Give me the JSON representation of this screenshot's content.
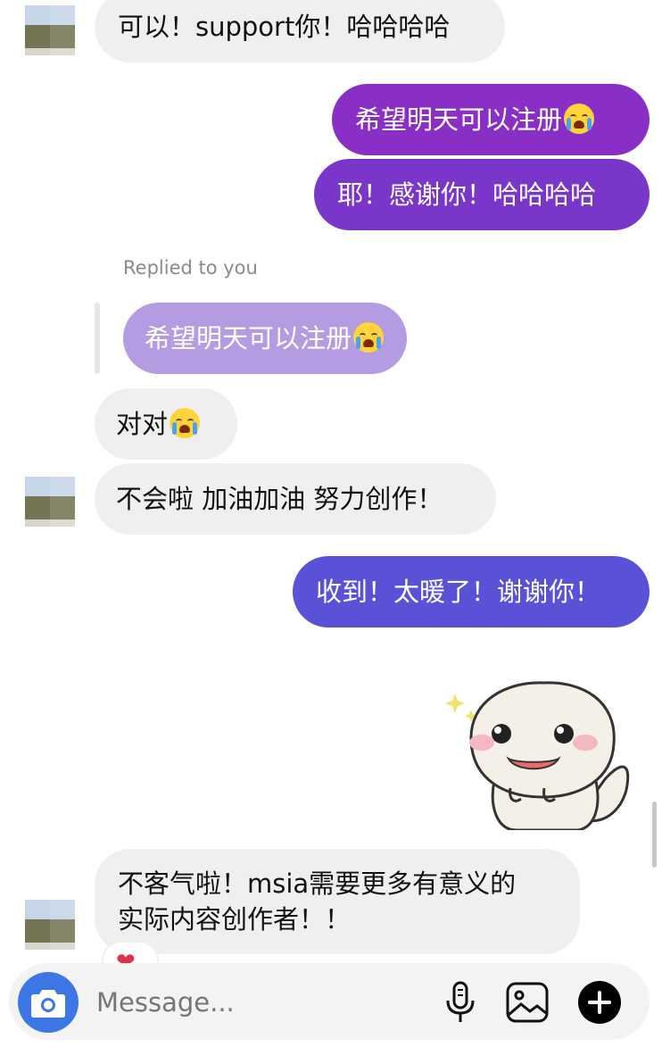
{
  "messages": {
    "m1": "可以！support你！哈哈哈哈",
    "m2": "希望明天可以注册",
    "m3": "耶！感谢你！哈哈哈哈",
    "reply_label": "Replied to you",
    "quoted": "希望明天可以注册",
    "m4": "对对",
    "m5": "不会啦 加油加油 努力创作！",
    "m6": "收到！太暖了！谢谢你！",
    "m7_line1": "不客气啦！msia需要更多有意义的",
    "m7_line2": "实际内容创作者！！"
  },
  "composer": {
    "placeholder": "Message..."
  },
  "colors": {
    "outgoing_top": "#8a2fc6",
    "outgoing_bottom": "#5a52d6",
    "quoted": "#b49be2",
    "incoming": "#efefef",
    "camera": "#3d77e6"
  },
  "icons": [
    "camera-icon",
    "mic-icon",
    "gallery-icon",
    "plus-icon",
    "crying-emoji",
    "heart-reaction-icon",
    "sticker"
  ]
}
